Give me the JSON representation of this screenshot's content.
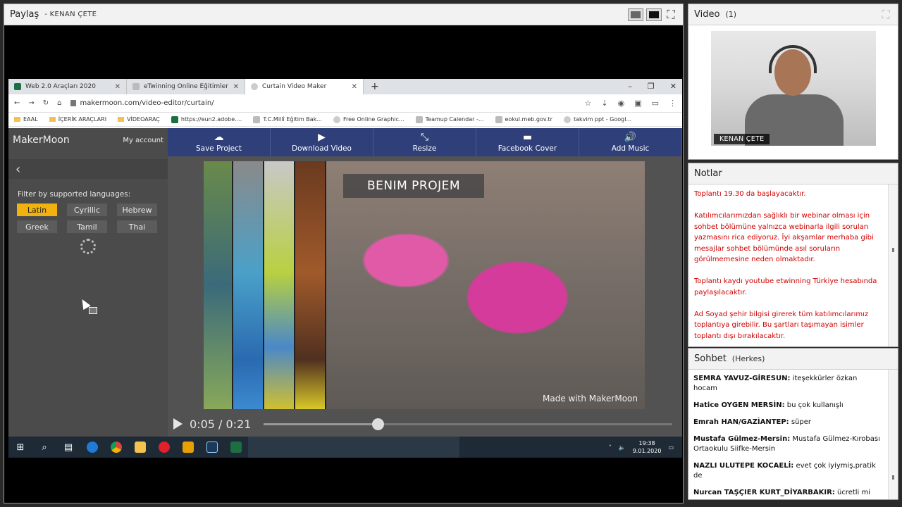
{
  "share_pod": {
    "title": "Paylaş",
    "presenter": "- KENAN ÇETE"
  },
  "browser": {
    "tabs": [
      {
        "label": "Web 2.0 Araçları 2020",
        "icon": "excel-icon"
      },
      {
        "label": "eTwinning Online Eğitimler",
        "icon": "doc-icon"
      },
      {
        "label": "Curtain Video Maker",
        "icon": "curtain-icon"
      }
    ],
    "url": "makermoon.com/video-editor/curtain/",
    "bookmarks": [
      "EAAL",
      "İÇERİK ARAÇLARI",
      "VİDEOARAÇ",
      "https://eun2.adobe....",
      "T.C.Millî Eğitim Bak...",
      "Free Online Graphic...",
      "Teamup Calendar -...",
      "eokul.meb.gov.tr",
      "takvim ppt - Googl..."
    ]
  },
  "makermoon": {
    "logo": "MakerMoon",
    "account": "My account",
    "filter_label": "Filter by supported languages:",
    "languages": [
      "Latin",
      "Cyrillic",
      "Hebrew",
      "Greek",
      "Tamil",
      "Thai"
    ],
    "active_language": "Latin",
    "toolbar": [
      "Save Project",
      "Download Video",
      "Resize",
      "Facebook Cover",
      "Add Music"
    ],
    "project_title": "BENIM PROJEM",
    "watermark": "Made with MakerMoon",
    "time_current": "0:05",
    "time_total": "0:21",
    "progress_fraction": 0.28
  },
  "taskbar": {
    "time": "19:38",
    "date": "9.01.2020"
  },
  "video_pod": {
    "title": "Video",
    "count": "(1)",
    "name_tag": "KENAN ÇETE"
  },
  "notes_pod": {
    "title": "Notlar",
    "paragraphs": [
      "Toplantı 19.30 da başlayacaktır.",
      "Katılımcılarımızdan sağlıklı bir webinar olması için sohbet bölümüne yalnızca webinarla ilgili soruları yazmasını rica ediyoruz. İyi akşamlar merhaba gibi mesajlar sohbet bölümünde asıl soruların görülmemesine neden olmaktadır.",
      "Toplantı kaydı youtube etwinning Türkiye hesabında paylaşılacaktır.",
      "Ad Soyad şehir bilgisi girerek tüm katılımcılarımız toplantıya girebilir. Bu şartları taşımayan isimler toplantı dışı bırakılacaktır."
    ]
  },
  "chat_pod": {
    "title": "Sohbet",
    "audience": "(Herkes)",
    "messages": [
      {
        "author": "SEMRA YAVUZ-GİRESUN:",
        "text": " iteşekkürler özkan hocam"
      },
      {
        "author": "Hatice OYGEN MERSİN:",
        "text": " bu çok kullanışlı"
      },
      {
        "author": "Emrah HAN/GAZİANTEP:",
        "text": " süper"
      },
      {
        "author": "Mustafa Gülmez-Mersin:",
        "text": " Mustafa Gülmez-Kırobası Ortaokulu Siifke-Mersin"
      },
      {
        "author": "NAZLI ULUTEPE KOCAELİ:",
        "text": " evet çok iyiymiş,pratik de"
      },
      {
        "author": "Nurcan TAŞÇIER KURT_DİYARBAKIR:",
        "text": " ücretli  mi"
      }
    ]
  }
}
